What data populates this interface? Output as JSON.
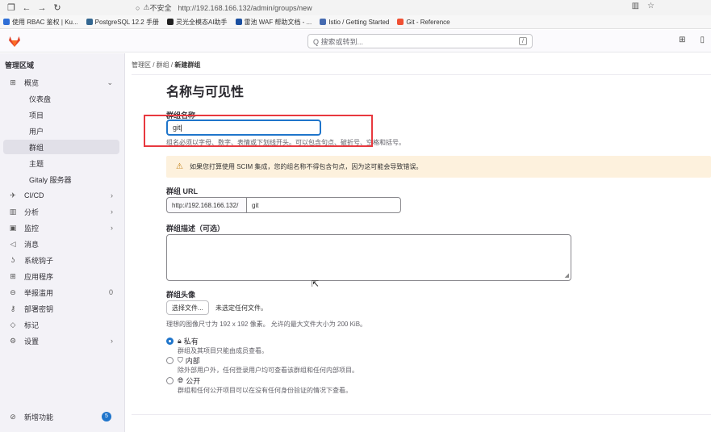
{
  "browser": {
    "warning": "不安全",
    "url": "http://192.168.166.132/admin/groups/new",
    "bookmarks": [
      "使用 RBAC 鉴权 | Ku...",
      "PostgreSQL 12.2 手册",
      "灵光全模态AI助手",
      "雷池 WAF 帮助文档 - ...",
      "Istio / Getting Started",
      "Git - Reference"
    ]
  },
  "topbar": {
    "search_placeholder": "Q 搜索或转到...",
    "search_shortcut": "/"
  },
  "sidebar": {
    "header": "管理区域",
    "items": [
      {
        "label": "概览",
        "icon": "grid-icon",
        "chevron": "⌄"
      },
      {
        "label": "仪表盘"
      },
      {
        "label": "项目"
      },
      {
        "label": "用户"
      },
      {
        "label": "群组"
      },
      {
        "label": "主题"
      },
      {
        "label": "Gitaly 服务器"
      },
      {
        "label": "CI/CD",
        "icon": "rocket-icon",
        "chevron": "›"
      },
      {
        "label": "分析",
        "icon": "chart-icon",
        "chevron": "›"
      },
      {
        "label": "监控",
        "icon": "monitor-icon",
        "chevron": "›"
      },
      {
        "label": "消息",
        "icon": "bullhorn-icon"
      },
      {
        "label": "系统钩子",
        "icon": "hook-icon"
      },
      {
        "label": "应用程序",
        "icon": "apps-icon"
      },
      {
        "label": "举报滥用",
        "icon": "abuse-icon",
        "count": "0"
      },
      {
        "label": "部署密钥",
        "icon": "key-icon"
      },
      {
        "label": "标记",
        "icon": "label-icon"
      },
      {
        "label": "设置",
        "icon": "gear-icon",
        "chevron": "›"
      }
    ],
    "whats_new": "新增功能",
    "whats_new_count": "5"
  },
  "breadcrumb": {
    "part1": "管理区",
    "part2": "群组",
    "part3": "新建群组"
  },
  "form": {
    "title": "名称与可见性",
    "name_label": "群组名称",
    "name_value": "git",
    "name_help": "组名必须以字母、数字、表情或下划线开头。可以包含句点、破折号、空格和括号。",
    "scim_alert": "如果您打算使用 SCIM 集成，您的组名称不得包含句点，因为这可能会导致错误。",
    "url_label": "群组 URL",
    "url_prefix": "http://192.168.166.132/",
    "url_value": "git",
    "desc_label": "群组描述（可选）",
    "avatar_label": "群组头像",
    "file_button": "选择文件...",
    "file_status": "未选定任何文件。",
    "avatar_help": "理想的图像尺寸为 192 x 192 像素。 允许的最大文件大小为 200 KiB。",
    "visibility": [
      {
        "label": "私有",
        "desc": "群组及其项目只能由成员查看。",
        "checked": true
      },
      {
        "label": "内部",
        "desc": "除外部用户外，任何登录用户均可查看该群组和任何内部项目。",
        "checked": false
      },
      {
        "label": "公开",
        "desc": "群组和任何公开项目可以在没有任何身份验证的情况下查看。",
        "checked": false
      }
    ]
  }
}
